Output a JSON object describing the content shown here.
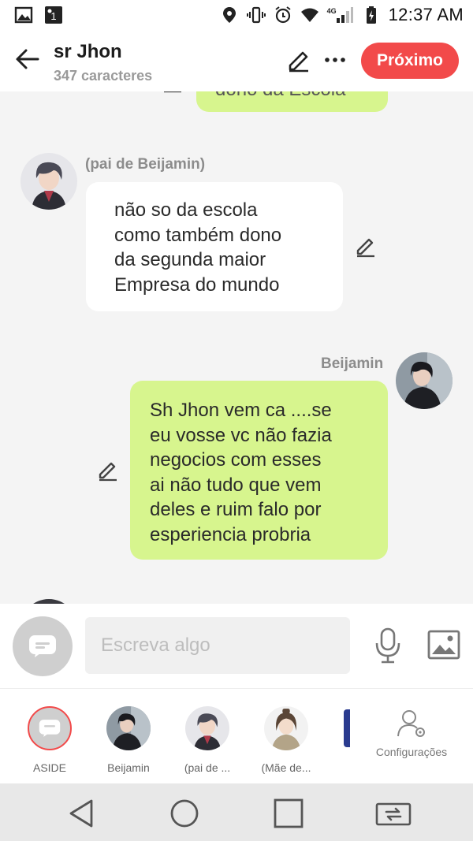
{
  "status_bar": {
    "time": "12:37 AM",
    "network": "4G",
    "icons": [
      "gallery-icon",
      "notification-icon",
      "location-icon",
      "vibrate-icon",
      "alarm-icon",
      "wifi-icon",
      "signal-icon",
      "battery-icon"
    ]
  },
  "header": {
    "title": "sr Jhon",
    "subtitle": "347 caracteres",
    "next_label": "Próximo"
  },
  "chat": {
    "top_partial_text": "dono da Escola",
    "messages": [
      {
        "sender": "(pai de Beijamin)",
        "side": "left",
        "text": "não so da escola\ncomo também dono\nda segunda maior\nEmpresa do mundo"
      },
      {
        "sender": "Beijamin",
        "side": "right",
        "text": "Sh Jhon vem ca ....se\neu vosse vc não fazia\nnegocios com esses\nai não tudo que vem\ndeles e ruim falo por\nesperiencia probria"
      }
    ]
  },
  "input": {
    "placeholder": "Escreva algo"
  },
  "characters": [
    {
      "label": "ASIDE"
    },
    {
      "label": "Beijamin"
    },
    {
      "label": "(pai de ..."
    },
    {
      "label": "(Mãe de..."
    }
  ],
  "settings_label": "Configurações",
  "colors": {
    "accent": "#f24a4a",
    "bubble_green": "#d7f58e",
    "background": "#f4f4f4"
  }
}
